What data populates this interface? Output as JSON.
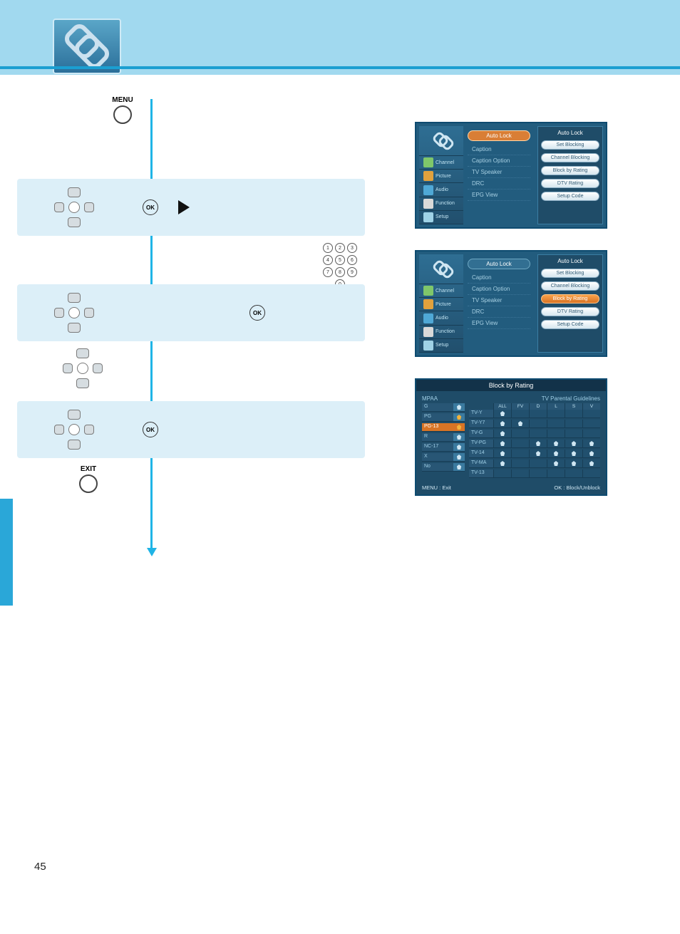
{
  "page_number": "45",
  "remote": {
    "menu_label": "MENU",
    "exit_label": "EXIT",
    "ok_label": "OK",
    "keys": [
      "1",
      "2",
      "3",
      "4",
      "5",
      "6",
      "7",
      "8",
      "9",
      "0"
    ]
  },
  "screen1": {
    "sidebar": {
      "items": [
        {
          "label": "Channel"
        },
        {
          "label": "Picture"
        },
        {
          "label": "Audio"
        },
        {
          "label": "Function"
        },
        {
          "label": "Setup"
        }
      ]
    },
    "mid_header": "Auto Lock",
    "mid_items": [
      "Caption",
      "Caption Option",
      "TV Speaker",
      "DRC",
      "EPG View"
    ],
    "right_title": "Auto Lock",
    "right_pills": [
      "Set Blocking",
      "Channel Blocking",
      "Block by Rating",
      "DTV Rating",
      "Setup Code"
    ]
  },
  "screen2": {
    "mid_header": "Auto Lock",
    "mid_items": [
      "Caption",
      "Caption Option",
      "TV Speaker",
      "DRC",
      "EPG View"
    ],
    "right_title": "Auto Lock",
    "right_pills": [
      "Set Blocking",
      "Channel Blocking",
      "Block by Rating",
      "DTV Rating",
      "Setup Code"
    ]
  },
  "rating": {
    "title": "Block by Rating",
    "left_header": "MPAA",
    "right_header": "TV Parental Guidelines",
    "right_cols": [
      "ALL",
      "FV",
      "D",
      "L",
      "S",
      "V"
    ],
    "mpaa_rows": [
      "G",
      "PG",
      "PG-13",
      "R",
      "NC-17",
      "X",
      "No"
    ],
    "tv_rows": [
      "TV-Y",
      "TV-Y7",
      "TV-G",
      "TV-PG",
      "TV-14",
      "TV-MA",
      "TV-13"
    ],
    "locked_mpaa_index": 2,
    "footer_left": "MENU : Exit",
    "footer_right": "OK : Block/Unblock"
  }
}
